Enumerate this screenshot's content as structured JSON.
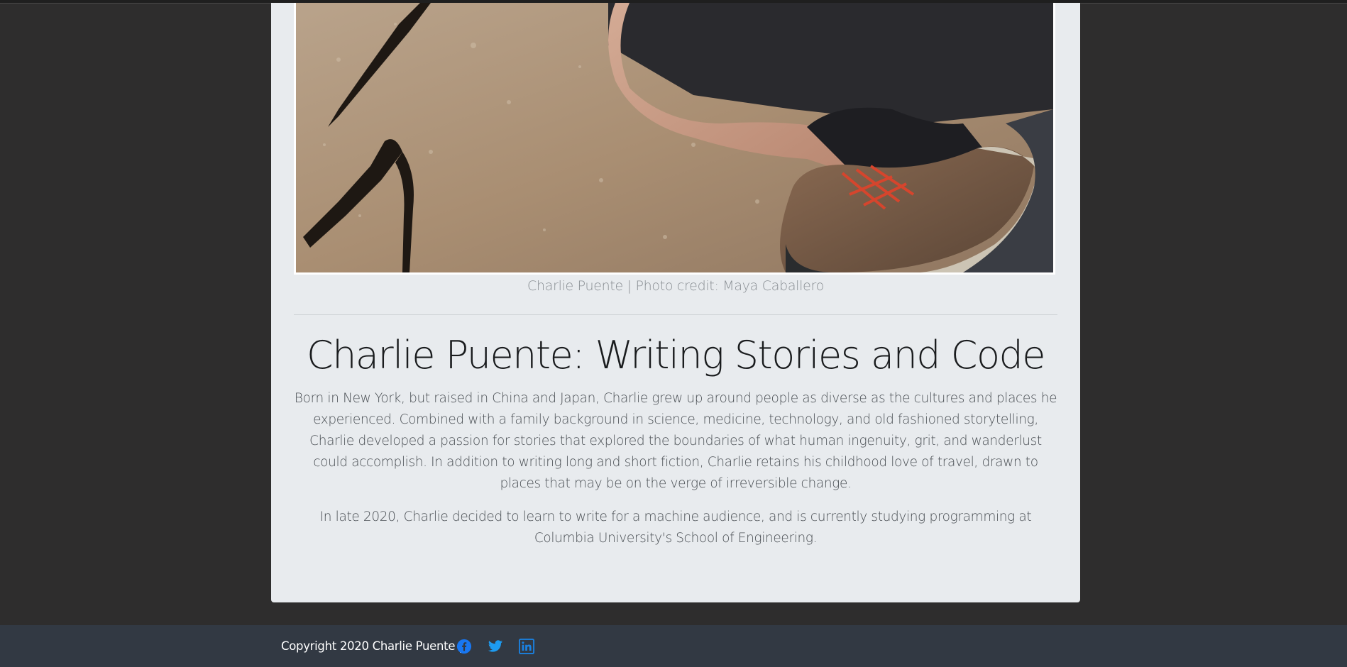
{
  "photo": {
    "alt": "Charlie Puente crouching on rock wearing hiking boots"
  },
  "caption": "Charlie Puente | Photo credit: Maya Caballero",
  "title": "Charlie Puente: Writing Stories and Code",
  "paragraphs": [
    "Born in New York, but raised in China and Japan, Charlie grew up around people as diverse as the cultures and places he experienced. Combined with a family background in science, medicine, technology, and old fashioned storytelling, Charlie developed a passion for stories that explored the boundaries of what human ingenuity, grit, and wanderlust could accomplish. In addition to writing long and short fiction, Charlie retains his childhood love of travel, drawn to places that may be on the verge of irreversible change.",
    "In late 2020, Charlie decided to learn to write for a machine audience, and is currently studying programming at Columbia University's School of Engineering."
  ],
  "footer": {
    "copyright": "Copyright 2020 Charlie Puente |",
    "social": [
      {
        "icon": "facebook-icon",
        "color": "#1877f2"
      },
      {
        "icon": "twitter-icon",
        "color": "#1d9bf0"
      },
      {
        "icon": "linkedin-icon",
        "color": "#0a66c2"
      }
    ]
  },
  "colors": {
    "page_background": "#2e2d2d",
    "card_background": "#e8ebee",
    "footer_background": "#323943",
    "link_blue": "#0d6efd"
  }
}
